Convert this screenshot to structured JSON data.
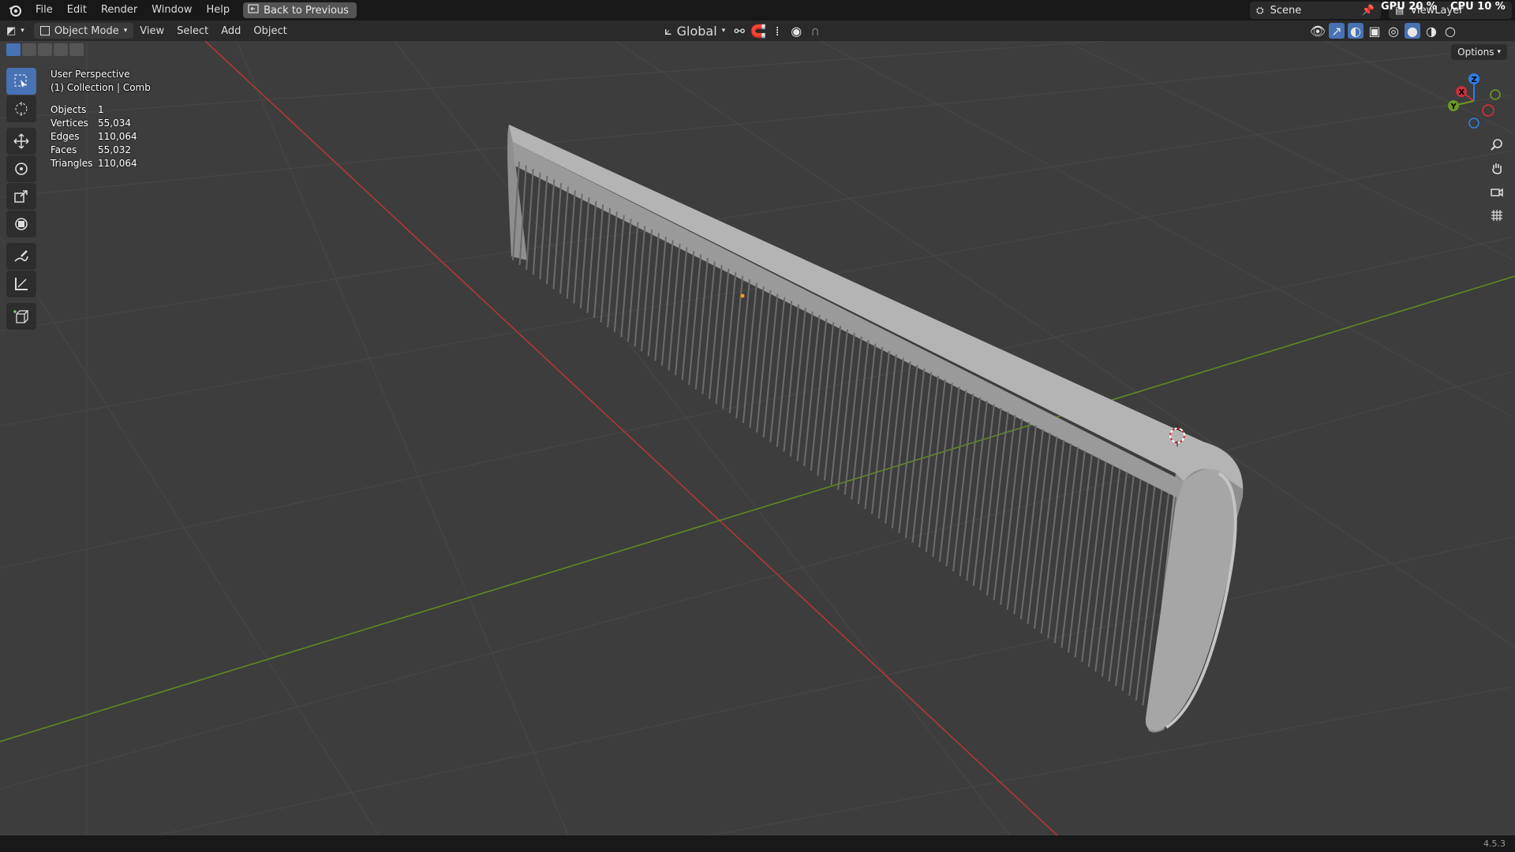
{
  "topbar": {
    "menus": [
      "File",
      "Edit",
      "Render",
      "Window",
      "Help"
    ],
    "back_button": "Back to Previous",
    "scene": "Scene",
    "view_layer": "ViewLayer",
    "gpu_label": "GPU",
    "gpu_value": "20 %",
    "cpu_label": "CPU",
    "cpu_value": "10 %"
  },
  "header": {
    "mode": "Object Mode",
    "menus": [
      "View",
      "Select",
      "Add",
      "Object"
    ],
    "transform_orientation": "Global",
    "options": "Options"
  },
  "overlay": {
    "perspective": "User Perspective",
    "collection": "(1) Collection | Comb",
    "stats": [
      {
        "label": "Objects",
        "value": "1"
      },
      {
        "label": "Vertices",
        "value": "55,034"
      },
      {
        "label": "Edges",
        "value": "110,064"
      },
      {
        "label": "Faces",
        "value": "55,032"
      },
      {
        "label": "Triangles",
        "value": "110,064"
      }
    ]
  },
  "gizmo": {
    "x": "X",
    "y": "Y",
    "z": "Z"
  },
  "status": {
    "version": "4.5.3"
  },
  "colors": {
    "accent": "#4772b3",
    "x_axis": "#c8303c",
    "y_axis": "#6b9a22",
    "z_axis": "#2f7de1"
  }
}
